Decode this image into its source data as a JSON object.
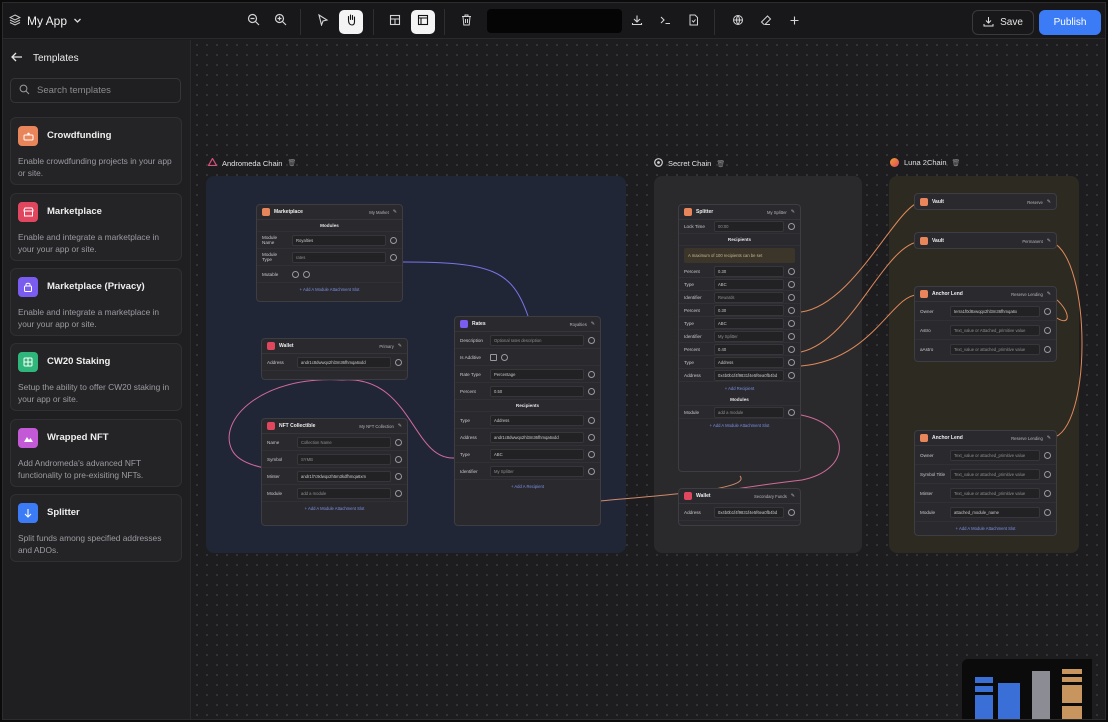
{
  "app": {
    "title": "My App"
  },
  "toolbar": {
    "save_label": "Save",
    "publish_label": "Publish",
    "icons": [
      "zoom-out-icon",
      "zoom-in-icon",
      "pointer-icon",
      "hand-icon",
      "layout-icon",
      "panel-icon",
      "trash-icon",
      "download-icon",
      "terminal-icon",
      "file-icon",
      "globe-icon",
      "eraser-icon",
      "plus-icon"
    ]
  },
  "sidebar": {
    "title": "Templates",
    "search_placeholder": "Search templates",
    "templates": [
      {
        "name": "Crowdfunding",
        "desc": "Enable crowdfunding projects in your app or site.",
        "color": "#e8855a",
        "icon": "crowdfund-icon"
      },
      {
        "name": "Marketplace",
        "desc": "Enable and integrate a marketplace in your your app or site.",
        "color": "#e0475f",
        "icon": "store-icon"
      },
      {
        "name": "Marketplace (Privacy)",
        "desc": "Enable and integrate a marketplace in your your app or site.",
        "color": "#7b5cf0",
        "icon": "lock-store-icon"
      },
      {
        "name": "CW20 Staking",
        "desc": "Setup the ability to offer CW20 staking in your app or site.",
        "color": "#2fb67a",
        "icon": "staking-icon"
      },
      {
        "name": "Wrapped NFT",
        "desc": "Add Andromeda's advanced NFT functionality to pre-exisiting NFTs.",
        "color": "#c459d8",
        "icon": "nft-icon"
      },
      {
        "name": "Splitter",
        "desc": "Split funds among specified addresses and ADOs.",
        "color": "#3b7bf6",
        "icon": "splitter-icon"
      }
    ]
  },
  "canvas": {
    "groups": [
      {
        "label": "Andromeda Chain",
        "color": "#d6527a"
      },
      {
        "label": "Secret Chain",
        "color": "#d0d0d0"
      },
      {
        "label": "Luna 2Chain",
        "color": "#f0a030"
      }
    ],
    "nodes": {
      "marketplace": {
        "title": "Marketplace",
        "sub": "My Market",
        "section": "Modules",
        "rows": [
          [
            "Module Name",
            "Royalties"
          ],
          [
            "Module Type",
            "rates"
          ],
          [
            "Mutable",
            ""
          ]
        ],
        "add": "+ Add A Module Attachment Slot"
      },
      "wallet1": {
        "title": "Wallet",
        "sub": "Primary",
        "rows": [
          [
            "Address",
            "andr1c8dwwqx2hl3m36fhmqa6xdd"
          ]
        ]
      },
      "nft": {
        "title": "NFT Collectible",
        "sub": "My NFT Collection",
        "rows": [
          [
            "Name",
            "Collection Name"
          ],
          [
            "Symbol",
            "SYMB"
          ],
          [
            "Minter",
            "andr1l7c9dwqx2h5m3kdfhmqa6xm"
          ],
          [
            "Module",
            "add a module"
          ]
        ],
        "add": "+ Add A Module Attachment Slot"
      },
      "rates": {
        "title": "Rates",
        "sub": "Royalties",
        "rows": [
          [
            "Description",
            "Optional rates description"
          ],
          [
            "Is Additive",
            ""
          ],
          [
            "Rate Type",
            "Percentage"
          ],
          [
            "Percent",
            "0.50"
          ]
        ],
        "section": "Recipients",
        "rows2": [
          [
            "Type",
            "Address"
          ],
          [
            "Address",
            "andr1c8dwwqx2hl3m36fhmqa6xdd"
          ],
          [
            "Type",
            "ABC"
          ],
          [
            "Identifier",
            "My Splitter"
          ]
        ],
        "add": "+ Add A Recipient"
      },
      "splitter": {
        "title": "Splitter",
        "sub": "My Splitter",
        "rows": [
          [
            "Lock Time",
            "00:00"
          ]
        ],
        "section": "Recipients",
        "note": "A maximum of 100 recipients can be set",
        "rows2": [
          [
            "Percent",
            "0.30"
          ],
          [
            "Type",
            "ABC"
          ],
          [
            "Identifier",
            "Rewards"
          ],
          [
            "Percent",
            "0.30"
          ],
          [
            "Type",
            "ABC"
          ],
          [
            "Identifier",
            "My Splitter"
          ],
          [
            "Percent",
            "0.40"
          ],
          [
            "Type",
            "Address"
          ],
          [
            "Address",
            "0x4b0b1f4f9831f4e5f6ea0fb4bd"
          ]
        ],
        "add": "+ Add Recipient",
        "section2": "Modules",
        "rows3": [
          [
            "Module",
            "add a module"
          ]
        ],
        "add2": "+ Add A Module Attachment Slot"
      },
      "wallet2": {
        "title": "Wallet",
        "sub": "Secondary Funds",
        "rows": [
          [
            "Address",
            "0x4b0b1f4f9831f4e5f6ea0fb4bd"
          ]
        ]
      },
      "vault1": {
        "title": "Vault",
        "sub": "Reserve"
      },
      "vault2": {
        "title": "Vault",
        "sub": "Permanent"
      },
      "anchor1": {
        "title": "Anchor Lend",
        "sub": "Reserve Lending",
        "rows": [
          [
            "Owner",
            "terra1f0d8xwqqx2hl3m36fhmqa6x"
          ],
          [
            "Astro",
            "Text_value or Attached_primitive value"
          ],
          [
            "aAstro",
            "Text_value or attached_primitive value"
          ]
        ]
      },
      "anchor2": {
        "title": "Anchor Lend",
        "sub": "Reserve Lending",
        "rows": [
          [
            "Owner",
            "Text_value or attached_primitive value"
          ],
          [
            "Symbol Title",
            "Text_value or attached_primitive value"
          ],
          [
            "Minter",
            "Text_value or attached_primitive value"
          ],
          [
            "Module",
            "attached_module_name"
          ]
        ],
        "add": "+ Add A Module Attachment Slot"
      }
    }
  }
}
